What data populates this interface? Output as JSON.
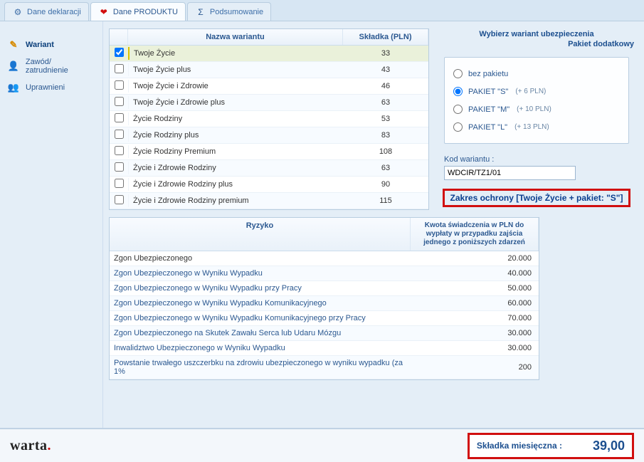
{
  "tabs": [
    {
      "label": "Dane deklaracji",
      "icon": "⚙"
    },
    {
      "label": "Dane  PRODUKTU",
      "icon": "❤"
    },
    {
      "label": "Podsumowanie",
      "icon": "Σ"
    }
  ],
  "sidebar": [
    {
      "label": "Wariant"
    },
    {
      "label": "Zawód/ zatrudnienie"
    },
    {
      "label": "Uprawnieni"
    }
  ],
  "variants": {
    "header_name": "Nazwa wariantu",
    "header_price": "Składka (PLN)",
    "rows": [
      {
        "name": "Twoje Życie",
        "price": "33",
        "checked": true
      },
      {
        "name": "Twoje Życie plus",
        "price": "43",
        "checked": false
      },
      {
        "name": "Twoje Życie i Zdrowie",
        "price": "46",
        "checked": false
      },
      {
        "name": "Twoje Życie i Zdrowie plus",
        "price": "63",
        "checked": false
      },
      {
        "name": "Życie Rodziny",
        "price": "53",
        "checked": false
      },
      {
        "name": "Życie Rodziny plus",
        "price": "83",
        "checked": false
      },
      {
        "name": "Życie Rodziny Premium",
        "price": "108",
        "checked": false
      },
      {
        "name": "Życie i Zdrowie Rodziny",
        "price": "63",
        "checked": false
      },
      {
        "name": "Życie i Zdrowie Rodziny plus",
        "price": "90",
        "checked": false
      },
      {
        "name": "Życie i Zdrowie Rodziny premium",
        "price": "115",
        "checked": false
      }
    ]
  },
  "right": {
    "title": "Wybierz wariant ubezpieczenia",
    "sub": "Pakiet dodatkowy",
    "packages": [
      {
        "label": "bez pakietu",
        "extra": "",
        "checked": false
      },
      {
        "label": "PAKIET \"S\"",
        "extra": "(+ 6 PLN)",
        "checked": true
      },
      {
        "label": "PAKIET \"M\"",
        "extra": "(+ 10 PLN)",
        "checked": false
      },
      {
        "label": "PAKIET \"L\"",
        "extra": "(+ 13 PLN)",
        "checked": false
      }
    ],
    "kod_label": "Kod wariantu :",
    "kod_value": "WDCIR/TZ1/01",
    "zakres": "Zakres ochrony [Twoje Życie + pakiet: \"S\"]"
  },
  "risks": {
    "header_risk": "Ryzyko",
    "header_amt": "Kwota świadczenia w PLN do wypłaty w przypadku zajścia jednego z poniższych zdarzeń",
    "rows": [
      {
        "name": "Zgon Ubezpieczonego",
        "amount": "20.000",
        "link": false
      },
      {
        "name": "Zgon Ubezpieczonego w Wyniku Wypadku",
        "amount": "40.000",
        "link": true
      },
      {
        "name": "Zgon Ubezpieczonego w Wyniku Wypadku przy Pracy",
        "amount": "50.000",
        "link": true
      },
      {
        "name": "Zgon Ubezpieczonego w Wyniku Wypadku Komunikacyjnego",
        "amount": "60.000",
        "link": true
      },
      {
        "name": "Zgon Ubezpieczonego w Wyniku Wypadku Komunikacyjnego przy Pracy",
        "amount": "70.000",
        "link": true
      },
      {
        "name": "Zgon Ubezpieczonego na Skutek Zawału Serca lub Udaru Mózgu",
        "amount": "30.000",
        "link": true
      },
      {
        "name": "Inwalidztwo Ubezpieczonego w Wyniku Wypadku",
        "amount": "30.000",
        "link": true
      },
      {
        "name": "Powstanie trwałego uszczerbku na zdrowiu ubezpieczonego w wyniku wypadku (za 1%",
        "amount": "200",
        "link": true
      }
    ]
  },
  "footer": {
    "brand": "warta",
    "premium_label": "Składka miesięczna :",
    "premium_value": "39,00"
  }
}
